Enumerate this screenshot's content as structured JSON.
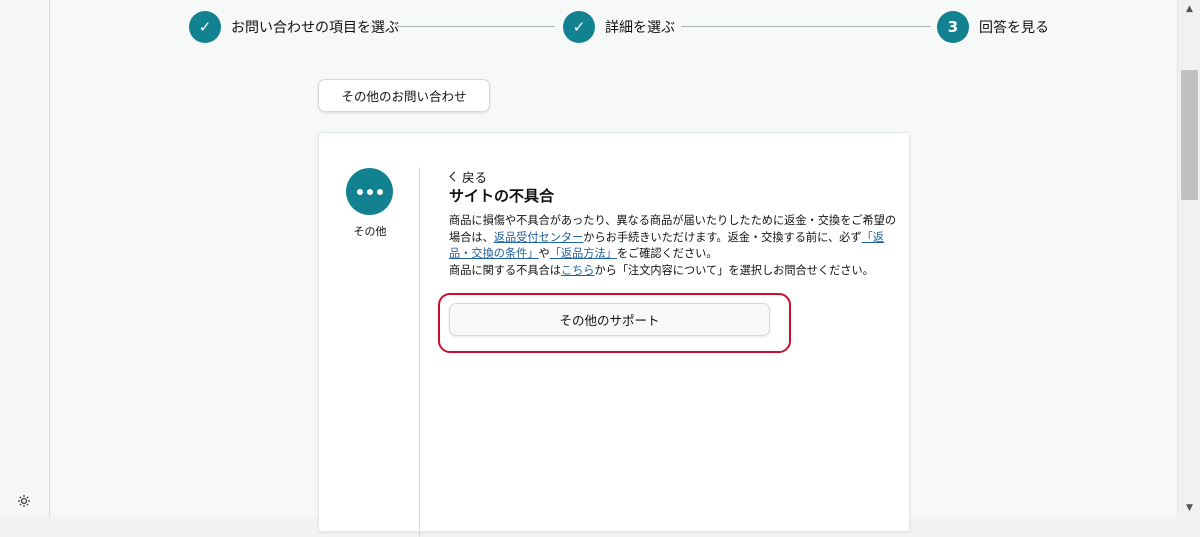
{
  "stepper": {
    "steps": [
      {
        "marker": "✓",
        "label": "お問い合わせの項目を選ぶ"
      },
      {
        "marker": "✓",
        "label": "詳細を選ぶ"
      },
      {
        "marker": "3",
        "label": "回答を見る"
      }
    ]
  },
  "other_inquiry_button": "その他のお問い合わせ",
  "card": {
    "category": {
      "icon": "more-dots-icon",
      "label": "その他"
    },
    "back_link": "戻る",
    "title": "サイトの不具合",
    "description": {
      "p1_before": "商品に損傷や不具合があったり、異なる商品が届いたりしたために返金・交換をご希望の場合は、",
      "p1_link": "返品受付センター",
      "p1_after": "からお手続きいただけます。返金・交換する前に、必ず",
      "p1_link2": "「返品・交換の条件」",
      "p1_mid": "や",
      "p1_link3": "「返品方法」",
      "p1_end": "をご確認ください。",
      "p2_before": "商品に関する不具合は",
      "p2_link": "こちら",
      "p2_after": "から「注文内容について」を選択しお問合せください。"
    },
    "support_button": "その他のサポート"
  },
  "colors": {
    "accent": "#138290",
    "highlight": "#c8102e",
    "link": "#2162a1"
  }
}
